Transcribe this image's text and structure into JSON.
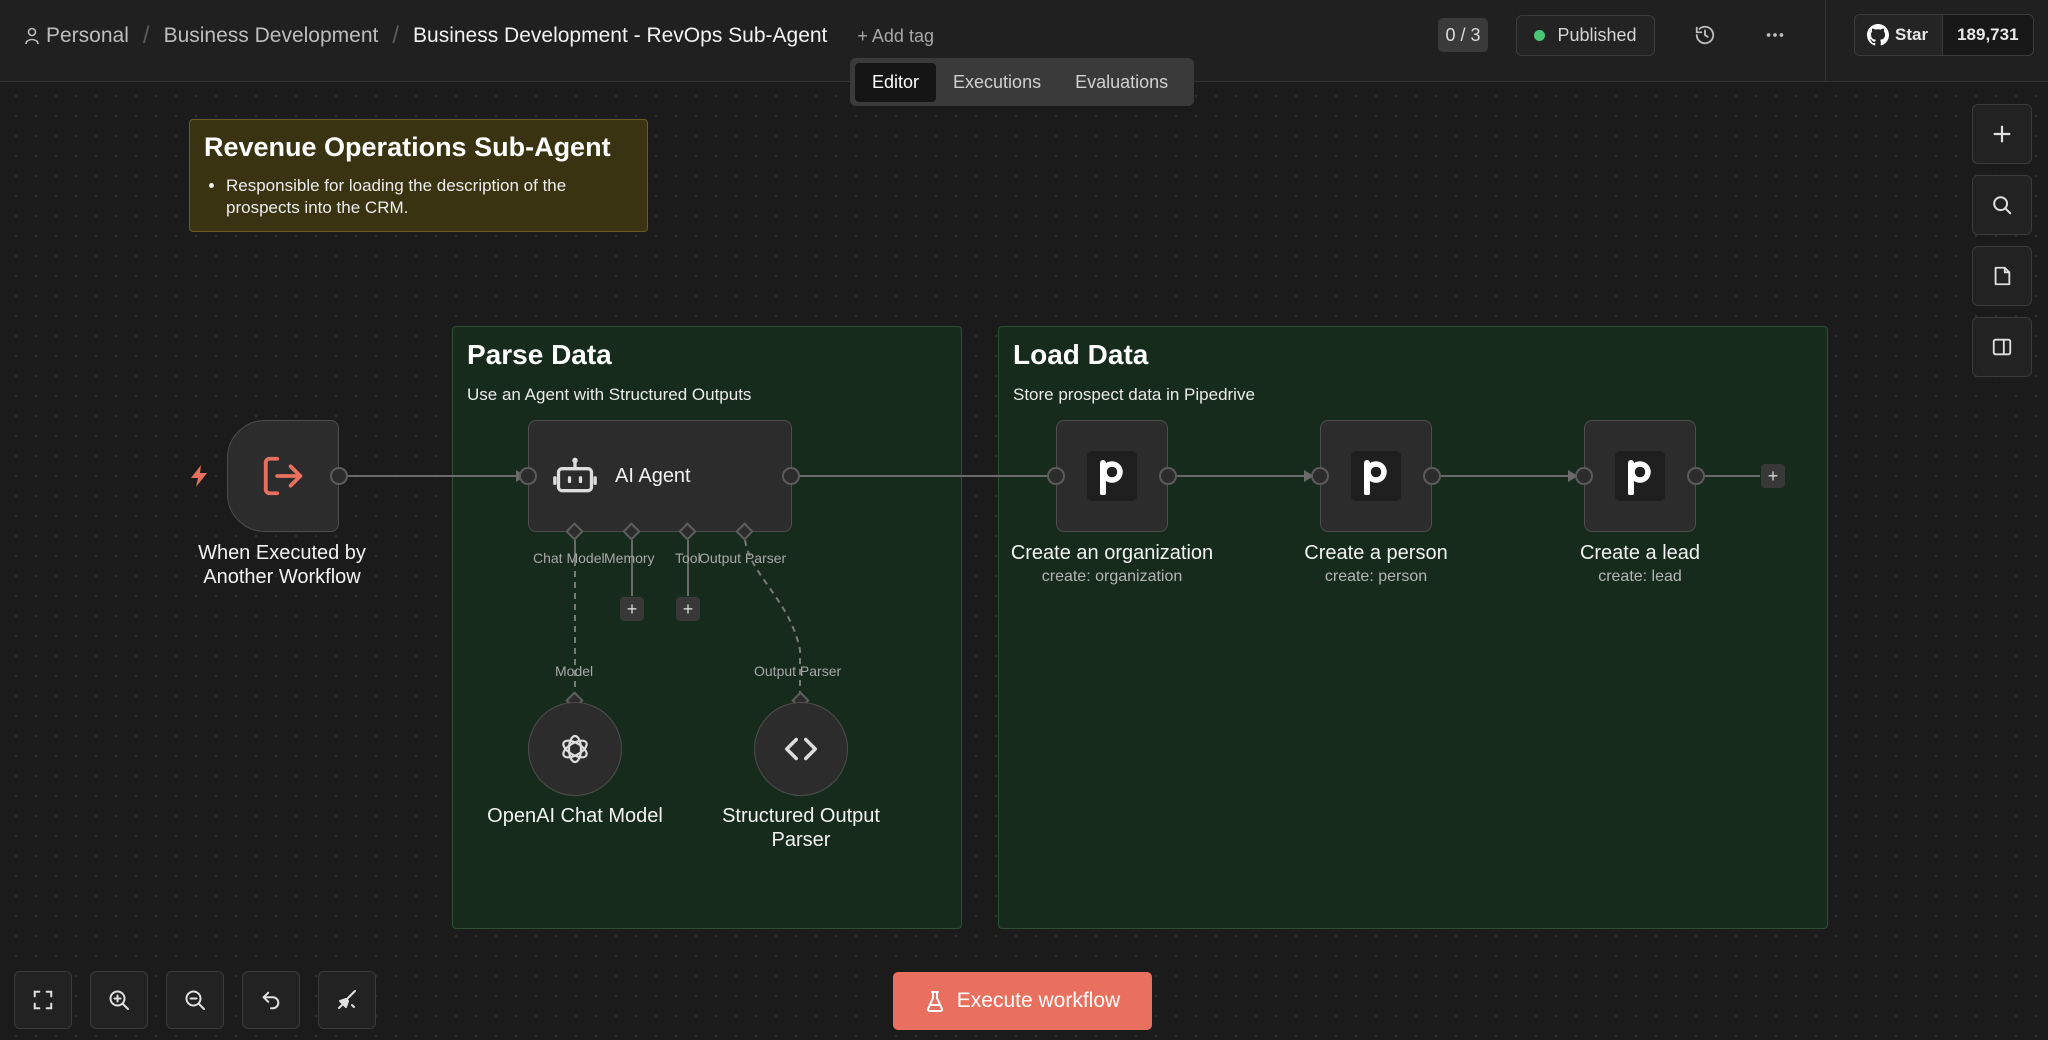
{
  "breadcrumb": {
    "items": [
      "Personal",
      "Business Development"
    ],
    "current": "Business Development - RevOps Sub-Agent",
    "add_tag": "+ Add tag"
  },
  "header": {
    "counter": "0 / 3",
    "status": "Published",
    "status_color": "#4ac776",
    "github_star": "Star",
    "github_count": "189,731"
  },
  "tabs": [
    "Editor",
    "Executions",
    "Evaluations"
  ],
  "active_tab": "Editor",
  "sticky_note": {
    "title": "Revenue Operations Sub-Agent",
    "bullet": "Responsible for loading the description of the prospects into the CRM."
  },
  "groups": {
    "parse": {
      "title": "Parse Data",
      "description": "Use an Agent with Structured Outputs"
    },
    "load": {
      "title": "Load Data",
      "description": "Store prospect data in Pipedrive"
    }
  },
  "nodes": {
    "trigger": {
      "label": "When Executed by Another Workflow",
      "icon": "sign-out-icon"
    },
    "agent": {
      "label": "AI Agent",
      "inputs": [
        "Chat Model",
        "Memory",
        "Tool",
        "Output Parser"
      ],
      "icon": "robot-icon"
    },
    "openai": {
      "label": "OpenAI Chat Model",
      "connector": "Model",
      "icon": "openai-icon"
    },
    "parser": {
      "label": "Structured Output Parser",
      "connector": "Output Parser",
      "icon": "code-icon"
    },
    "create_org": {
      "label": "Create an organization",
      "sub": "create: organization",
      "icon": "pipedrive-icon"
    },
    "create_person": {
      "label": "Create a person",
      "sub": "create: person",
      "icon": "pipedrive-icon"
    },
    "create_lead": {
      "label": "Create a lead",
      "sub": "create: lead",
      "icon": "pipedrive-icon"
    }
  },
  "execute_button": "Execute workflow",
  "colors": {
    "accent": "#e9705e",
    "trigger_icon": "#e9705e",
    "sticky_bg": "#3a3312",
    "group_bg": "#162c1c"
  }
}
